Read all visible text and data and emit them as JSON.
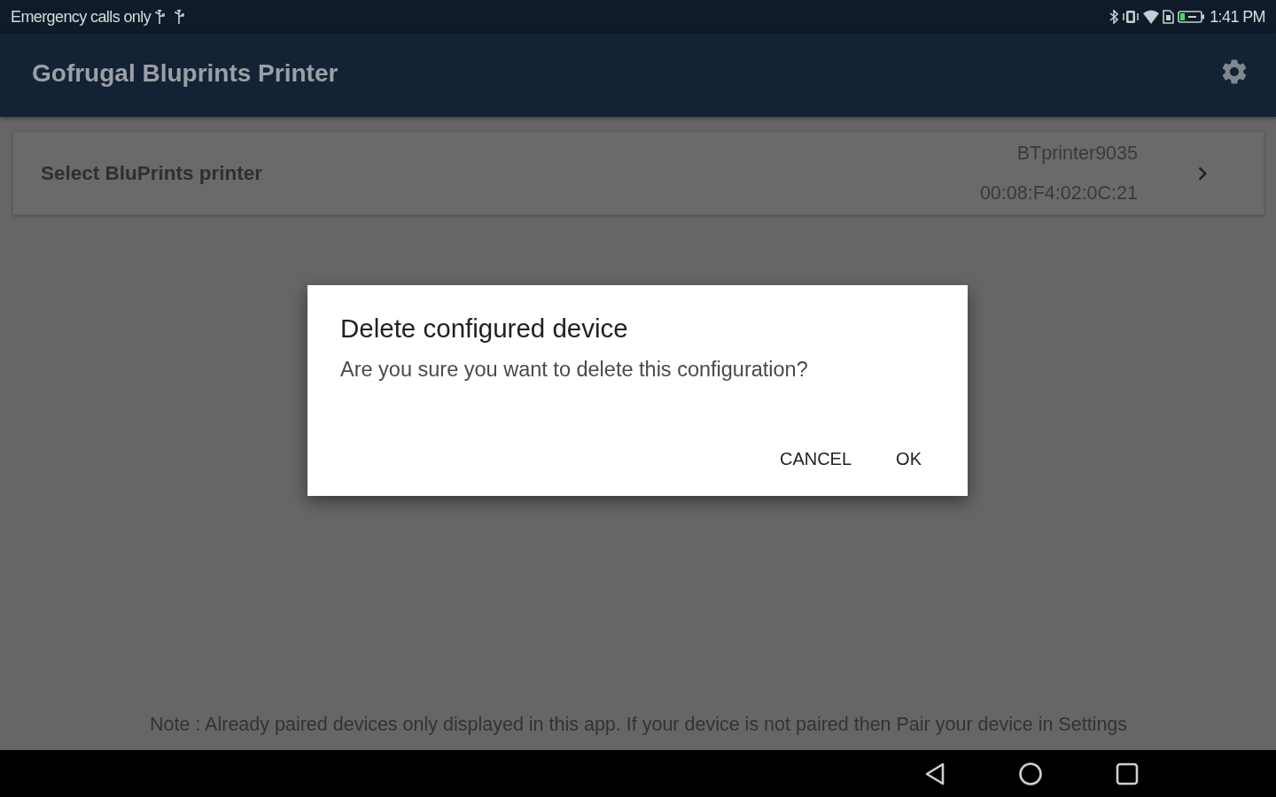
{
  "status_bar": {
    "carrier": "Emergency calls only",
    "time": "1:41 PM"
  },
  "app_bar": {
    "title": "Gofrugal Bluprints Printer"
  },
  "printer_row": {
    "label": "Select BluPrints printer",
    "device_name": "BTprinter9035",
    "device_address": "00:08:F4:02:0C:21"
  },
  "dialog": {
    "title": "Delete configured device",
    "message": "Are you sure you want to delete this configuration?",
    "buttons": [
      "CANCEL",
      "OK"
    ]
  },
  "note": "Note : Already paired devices only displayed in this app. If your device is not paired then Pair your device in Settings"
}
